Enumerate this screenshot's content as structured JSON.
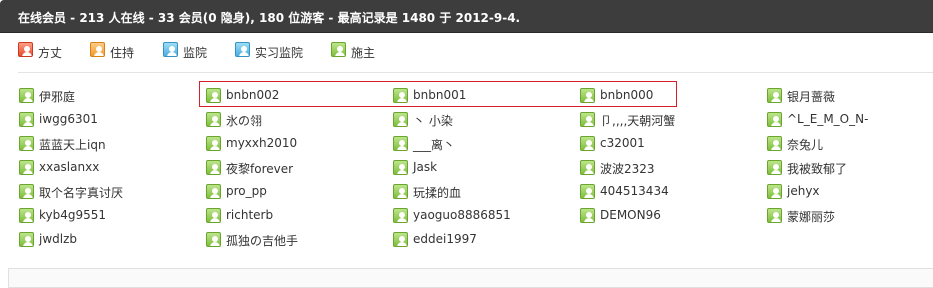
{
  "header": {
    "text": "在线会员 - 213 人在线 - 33 会员(0 隐身), 180 位游客 - 最高记录是 1480 于 2012-9-4."
  },
  "legend": [
    {
      "label": "方丈",
      "icon": "admin-user-icon"
    },
    {
      "label": "住持",
      "icon": "super-moderator-user-icon"
    },
    {
      "label": "监院",
      "icon": "moderator-user-icon"
    },
    {
      "label": "实习监院",
      "icon": "intern-moderator-user-icon"
    },
    {
      "label": "施主",
      "icon": "member-user-icon"
    }
  ],
  "users": [
    [
      "伊邪庭",
      "bnbn002",
      "bnbn001",
      "bnbn000",
      "银月蔷薇"
    ],
    [
      "iwgg6301",
      "氷の翎",
      "丶 小染",
      "卩,,,,天朝河蟹",
      "^L_E_M_O_N-"
    ],
    [
      "蓝蓝天上iqn",
      "myxxh2010",
      "___离丶",
      "c32001",
      "奈兔儿"
    ],
    [
      "xxaslanxx",
      "夜黎forever",
      "Jask",
      "波波2323",
      "我被致郁了"
    ],
    [
      "取个名字真讨厌",
      "pro_pp",
      "玩揉的血",
      "404513434",
      "jehyx"
    ],
    [
      "kyb4g9551",
      "richterb",
      "yaoguo8886851",
      "DEMON96",
      "蒙娜丽莎"
    ],
    [
      "jwdlzb",
      "孤独の吉他手",
      "eddei1997"
    ]
  ],
  "colors": {
    "header_bg": "#3d3d3d",
    "highlight_border": "#d8202a",
    "member_icon": "#7fbf3c"
  }
}
